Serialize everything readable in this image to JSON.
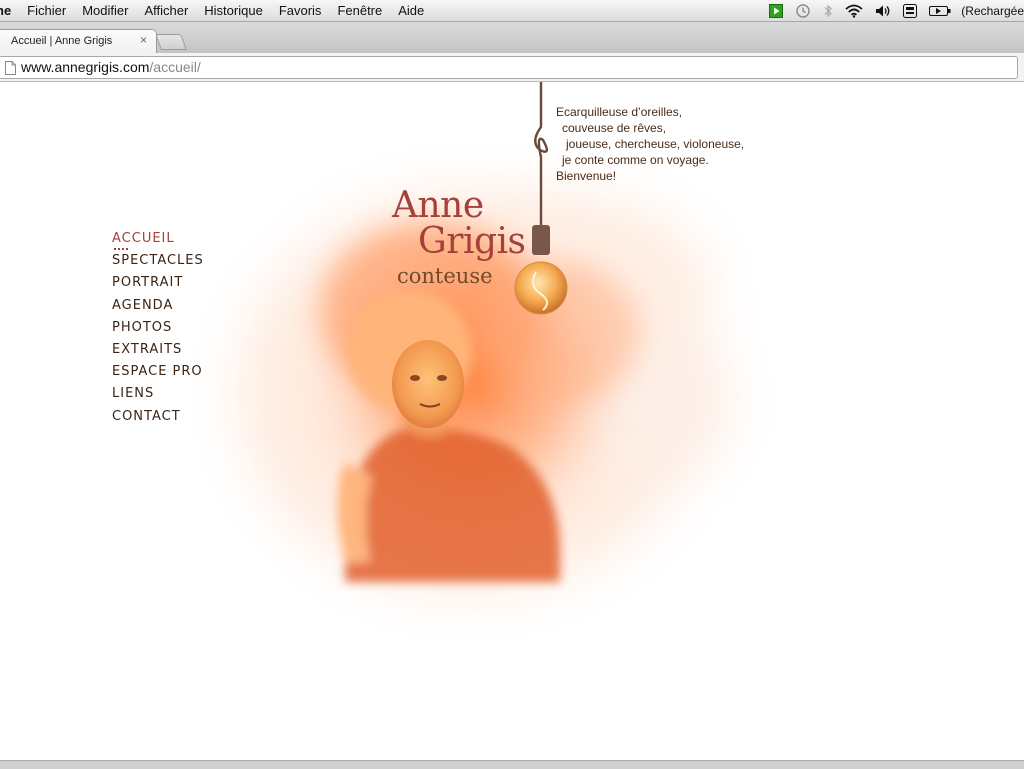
{
  "menubar": {
    "app_name": "ne",
    "items": [
      "Fichier",
      "Modifier",
      "Afficher",
      "Historique",
      "Favoris",
      "Fenêtre",
      "Aide"
    ],
    "status_icons": [
      "media-icon",
      "time-machine-icon",
      "bluetooth-icon",
      "wifi-icon",
      "volume-icon",
      "keyboard-icon",
      "battery-icon"
    ],
    "battery_label": "(Rechargée"
  },
  "browser": {
    "tab_title": "Accueil | Anne Grigis",
    "tab_close": "×",
    "url_domain": "www.annegrigis.com",
    "url_path": "/accueil/"
  },
  "site": {
    "nav": [
      "ACCUEIL",
      "SPECTACLES",
      "PORTRAIT",
      "AGENDA",
      "PHOTOS",
      "EXTRAITS",
      "ESPACE PRO",
      "LIENS",
      "CONTACT"
    ],
    "active_nav": "ACCUEIL",
    "title_first": "Anne",
    "title_last": "Grigis",
    "subtitle": "conteuse",
    "tagline": [
      "Ecarquilleuse d’oreilles,",
      "  couveuse de rêves,",
      "   joueuse, chercheuse, violoneuse,",
      "  je conte comme on voyage.",
      "Bienvenue!"
    ],
    "colors": {
      "accent": "#a3413a",
      "text": "#3a2416",
      "cloud_orange": "#f07a3c"
    }
  }
}
